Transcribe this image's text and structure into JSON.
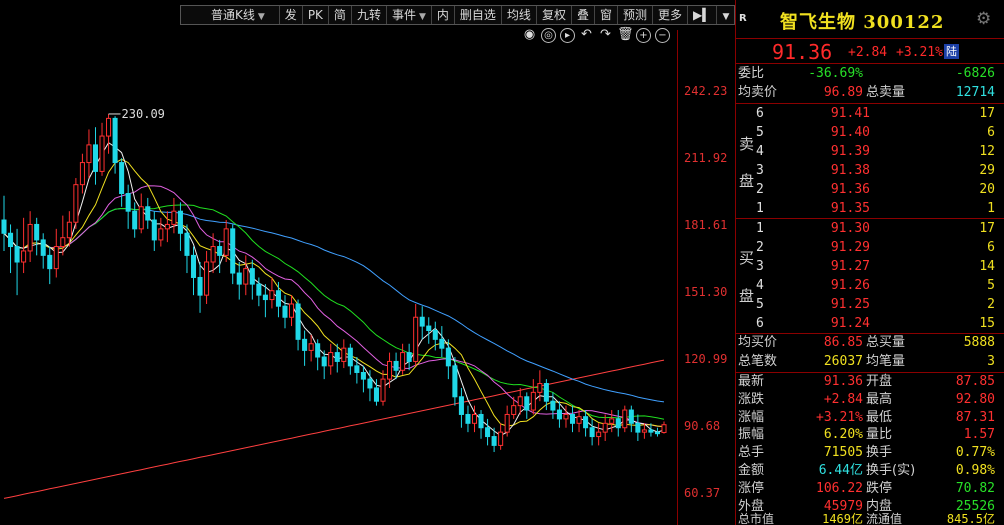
{
  "toolbar": {
    "items": [
      "普通K线",
      "发",
      "PK",
      "简",
      "九转",
      "事件",
      "内",
      "删自选",
      "均线",
      "复权",
      "叠",
      "窗",
      "预测",
      "更多"
    ]
  },
  "chart_tools": [
    "eye-icon",
    "camera-icon",
    "play-icon",
    "undo-icon",
    "redo-icon",
    "delete-icon",
    "zoom-in-icon",
    "zoom-out-icon"
  ],
  "chart_data": {
    "type": "candlestick",
    "y_ticks": [
      "242.23",
      "211.92",
      "181.61",
      "151.30",
      "120.99",
      "90.68",
      "60.37"
    ],
    "ylim": [
      50.5,
      270
    ],
    "peak_label": "230.09",
    "colors": {
      "up": "#ff3030",
      "down": "#20d8e8",
      "ma5": "#f0f0f0",
      "ma10": "#f0e020",
      "ma20": "#e060e0",
      "ma30": "#20e020",
      "ma60": "#40a0ff",
      "ma250": "#ff4040"
    },
    "candles": [
      [
        184,
        178,
        195,
        170
      ],
      [
        178,
        172,
        182,
        160
      ],
      [
        172,
        165,
        180,
        150
      ],
      [
        165,
        170,
        185,
        160
      ],
      [
        170,
        182,
        188,
        165
      ],
      [
        182,
        175,
        185,
        168
      ],
      [
        175,
        168,
        178,
        162
      ],
      [
        168,
        162,
        172,
        155
      ],
      [
        162,
        172,
        180,
        158
      ],
      [
        172,
        176,
        186,
        168
      ],
      [
        176,
        183,
        188,
        172
      ],
      [
        183,
        200,
        203,
        180
      ],
      [
        200,
        210,
        214,
        196
      ],
      [
        210,
        218,
        225,
        203
      ],
      [
        218,
        206,
        226,
        200
      ],
      [
        206,
        222,
        228,
        204
      ],
      [
        222,
        230,
        232,
        214
      ],
      [
        230,
        210,
        231,
        205
      ],
      [
        210,
        196,
        212,
        190
      ],
      [
        196,
        188,
        200,
        180
      ],
      [
        188,
        180,
        192,
        176
      ],
      [
        180,
        190,
        196,
        178
      ],
      [
        190,
        184,
        194,
        180
      ],
      [
        184,
        175,
        188,
        170
      ],
      [
        175,
        180,
        185,
        172
      ],
      [
        180,
        182,
        188,
        174
      ],
      [
        182,
        188,
        194,
        178
      ],
      [
        188,
        178,
        192,
        170
      ],
      [
        178,
        168,
        182,
        160
      ],
      [
        168,
        158,
        172,
        150
      ],
      [
        158,
        150,
        165,
        142
      ],
      [
        150,
        165,
        170,
        146
      ],
      [
        165,
        172,
        178,
        160
      ],
      [
        172,
        168,
        175,
        160
      ],
      [
        168,
        180,
        184,
        165
      ],
      [
        180,
        160,
        182,
        155
      ],
      [
        160,
        155,
        165,
        148
      ],
      [
        155,
        162,
        168,
        150
      ],
      [
        162,
        155,
        166,
        148
      ],
      [
        155,
        150,
        158,
        145
      ],
      [
        150,
        148,
        155,
        140
      ],
      [
        148,
        152,
        158,
        144
      ],
      [
        152,
        145,
        156,
        140
      ],
      [
        145,
        140,
        150,
        135
      ],
      [
        140,
        146,
        150,
        136
      ],
      [
        146,
        130,
        148,
        125
      ],
      [
        130,
        125,
        134,
        118
      ],
      [
        125,
        128,
        132,
        120
      ],
      [
        128,
        122,
        130,
        116
      ],
      [
        122,
        118,
        125,
        112
      ],
      [
        118,
        124,
        128,
        114
      ],
      [
        124,
        120,
        128,
        115
      ],
      [
        120,
        126,
        130,
        117
      ],
      [
        126,
        118,
        128,
        114
      ],
      [
        118,
        115,
        122,
        110
      ],
      [
        115,
        112,
        118,
        106
      ],
      [
        112,
        108,
        116,
        102
      ],
      [
        108,
        102,
        112,
        100
      ],
      [
        102,
        112,
        116,
        100
      ],
      [
        112,
        120,
        124,
        108
      ],
      [
        120,
        116,
        124,
        112
      ],
      [
        116,
        124,
        128,
        114
      ],
      [
        124,
        120,
        128,
        116
      ],
      [
        120,
        140,
        146,
        118
      ],
      [
        140,
        136,
        145,
        130
      ],
      [
        136,
        134,
        140,
        128
      ],
      [
        134,
        130,
        138,
        125
      ],
      [
        130,
        126,
        136,
        122
      ],
      [
        126,
        118,
        130,
        112
      ],
      [
        118,
        104,
        122,
        100
      ],
      [
        104,
        96,
        108,
        90
      ],
      [
        96,
        92,
        100,
        88
      ],
      [
        92,
        96,
        100,
        88
      ],
      [
        96,
        90,
        98,
        85
      ],
      [
        90,
        86,
        94,
        82
      ],
      [
        86,
        82,
        90,
        79
      ],
      [
        82,
        88,
        92,
        80
      ],
      [
        88,
        96,
        100,
        86
      ],
      [
        96,
        100,
        104,
        94
      ],
      [
        100,
        104,
        108,
        96
      ],
      [
        104,
        98,
        106,
        94
      ],
      [
        98,
        106,
        112,
        96
      ],
      [
        106,
        110,
        116,
        102
      ],
      [
        110,
        102,
        112,
        98
      ],
      [
        102,
        98,
        106,
        94
      ],
      [
        98,
        94,
        102,
        90
      ],
      [
        94,
        96,
        100,
        90
      ],
      [
        96,
        92,
        100,
        88
      ],
      [
        92,
        95,
        98,
        88
      ],
      [
        95,
        90,
        98,
        86
      ],
      [
        90,
        86,
        94,
        82
      ],
      [
        86,
        88,
        92,
        82
      ],
      [
        88,
        92,
        96,
        84
      ],
      [
        92,
        94,
        98,
        88
      ],
      [
        94,
        90,
        98,
        86
      ],
      [
        90,
        98,
        100,
        88
      ],
      [
        98,
        92,
        100,
        88
      ],
      [
        92,
        88,
        96,
        84
      ],
      [
        88,
        89,
        92,
        85
      ],
      [
        89,
        88,
        92,
        86
      ],
      [
        88,
        87.31,
        90,
        86
      ],
      [
        87.85,
        91.36,
        92.8,
        87.31
      ]
    ]
  },
  "quote": {
    "badge": "R",
    "title": "智飞生物 300122",
    "price": "91.36",
    "change": "+2.84",
    "pct": "+3.21%",
    "exchange": "陆",
    "wei_bi_label": "委比",
    "wei_bi": "-36.69%",
    "wei_cha": "-6826",
    "jun_mai_label": "均卖价",
    "jun_mai": "96.89",
    "zong_mai_label": "总卖量",
    "zong_mai": "12714",
    "sell_label": [
      "卖",
      "盘"
    ],
    "buy_label": [
      "买",
      "盘"
    ],
    "asks": [
      {
        "lvl": "6",
        "price": "91.41",
        "vol": "17"
      },
      {
        "lvl": "5",
        "price": "91.40",
        "vol": "6"
      },
      {
        "lvl": "4",
        "price": "91.39",
        "vol": "12"
      },
      {
        "lvl": "3",
        "price": "91.38",
        "vol": "29"
      },
      {
        "lvl": "2",
        "price": "91.36",
        "vol": "20"
      },
      {
        "lvl": "1",
        "price": "91.35",
        "vol": "1"
      }
    ],
    "bids": [
      {
        "lvl": "1",
        "price": "91.30",
        "vol": "17"
      },
      {
        "lvl": "2",
        "price": "91.29",
        "vol": "6"
      },
      {
        "lvl": "3",
        "price": "91.27",
        "vol": "14"
      },
      {
        "lvl": "4",
        "price": "91.26",
        "vol": "5"
      },
      {
        "lvl": "5",
        "price": "91.25",
        "vol": "2"
      },
      {
        "lvl": "6",
        "price": "91.24",
        "vol": "15"
      }
    ],
    "jun_mai2_label": "均买价",
    "jun_mai2": "86.85",
    "zong_mai2_label": "总买量",
    "zong_mai2": "5888",
    "zong_bi_label": "总笔数",
    "zong_bi": "26037",
    "jun_bi_label": "均笔量",
    "jun_bi": "3",
    "stats": [
      {
        "l1": "最新",
        "v1": "91.36",
        "c1": "red",
        "l2": "开盘",
        "v2": "87.85",
        "c2": "red"
      },
      {
        "l1": "涨跌",
        "v1": "+2.84",
        "c1": "red",
        "l2": "最高",
        "v2": "92.80",
        "c2": "red"
      },
      {
        "l1": "涨幅",
        "v1": "+3.21%",
        "c1": "red",
        "l2": "最低",
        "v2": "87.31",
        "c2": "red"
      },
      {
        "l1": "振幅",
        "v1": "6.20%",
        "c1": "yellow",
        "l2": "量比",
        "v2": "1.57",
        "c2": "red"
      },
      {
        "l1": "总手",
        "v1": "71505",
        "c1": "yellow",
        "l2": "换手",
        "v2": "0.77%",
        "c2": "yellow"
      },
      {
        "l1": "金额",
        "v1": "6.44亿",
        "c1": "cyan",
        "l2": "换手(实)",
        "v2": "0.98%",
        "c2": "yellow"
      },
      {
        "l1": "涨停",
        "v1": "106.22",
        "c1": "red",
        "l2": "跌停",
        "v2": "70.82",
        "c2": "green"
      },
      {
        "l1": "外盘",
        "v1": "45979",
        "c1": "red",
        "l2": "内盘",
        "v2": "25526",
        "c2": "green"
      }
    ],
    "fade_row": {
      "l1": "总市值",
      "v1": "1469亿",
      "l2": "流通值",
      "v2": "845.5亿"
    }
  }
}
